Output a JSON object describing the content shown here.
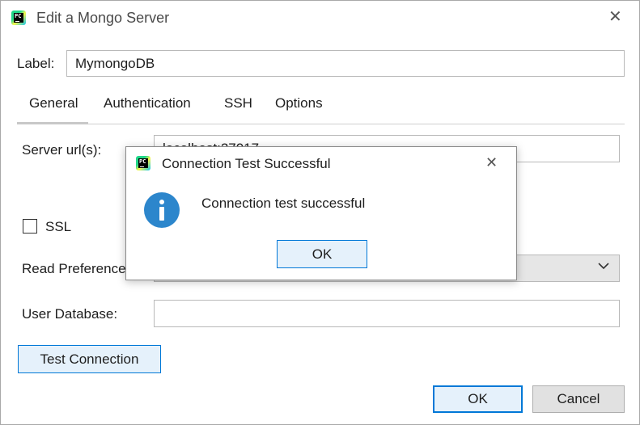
{
  "window": {
    "title": "Edit a Mongo Server",
    "app_icon_text": "PC"
  },
  "form": {
    "label_caption": "Label:",
    "label_value": "MymongoDB",
    "tabs": [
      {
        "label": "General"
      },
      {
        "label": "Authentication"
      },
      {
        "label": "SSH"
      },
      {
        "label": "Options"
      }
    ],
    "active_tab": "General",
    "server_url_caption": "Server url(s):",
    "server_url_partial": "localhost:27017",
    "ssl_label": "SSL",
    "ssl_checked": false,
    "read_preference_caption": "Read  Preference",
    "user_database_caption": "User Database:",
    "user_database_value": ""
  },
  "buttons": {
    "test_connection": "Test Connection",
    "ok": "OK",
    "cancel": "Cancel"
  },
  "modal": {
    "title": "Connection Test Successful",
    "message": "Connection test successful",
    "ok": "OK",
    "icon": "info-icon"
  },
  "colors": {
    "accent": "#0078d7",
    "info": "#2c86cc"
  }
}
